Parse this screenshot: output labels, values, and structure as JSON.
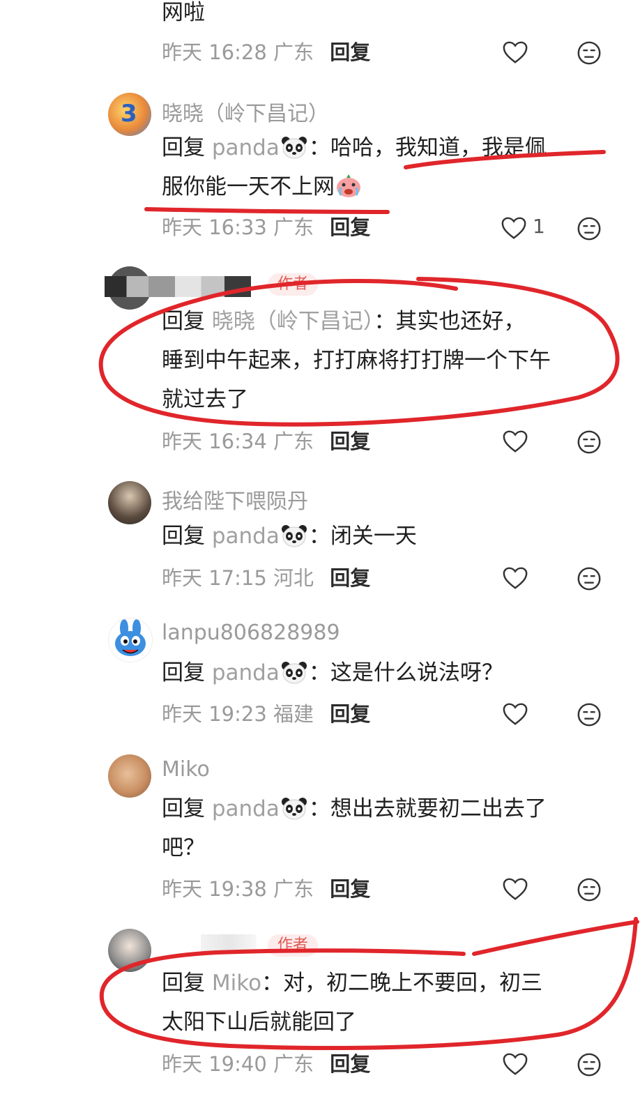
{
  "top_fragment": {
    "text": "网啦",
    "meta": {
      "date": "昨天",
      "time": "16:28",
      "region": "广东",
      "reply": "回复"
    }
  },
  "comments": [
    {
      "name": "晓晓（岭下昌记）",
      "reply_prefix": "回复",
      "reply_target": "panda",
      "sep": "：",
      "text_line1": "哈哈，我知道，我是佩",
      "text_line2": "服你能一天不上网",
      "meta": {
        "date": "昨天",
        "time": "16:33",
        "region": "广东",
        "reply": "回复"
      },
      "likes": "1"
    },
    {
      "badge": "作者",
      "reply_prefix": "回复",
      "reply_target": "晓晓（岭下昌记）",
      "sep": "：",
      "text_line1": "其实也还好，",
      "text_line2": "睡到中午起来，打打麻将打打牌一个下午",
      "text_line3": "就过去了",
      "meta": {
        "date": "昨天",
        "time": "16:34",
        "region": "广东",
        "reply": "回复"
      }
    },
    {
      "name": "我给陛下喂陨丹",
      "reply_prefix": "回复",
      "reply_target": "panda",
      "sep": "：",
      "text_line1": "闭关一天",
      "meta": {
        "date": "昨天",
        "time": "17:15",
        "region": "河北",
        "reply": "回复"
      }
    },
    {
      "name": "lanpu806828989",
      "reply_prefix": "回复",
      "reply_target": "panda",
      "sep": "：",
      "text_line1": "这是什么说法呀？",
      "meta": {
        "date": "昨天",
        "time": "19:23",
        "region": "福建",
        "reply": "回复"
      }
    },
    {
      "name": "Miko",
      "reply_prefix": "回复",
      "reply_target": "panda",
      "sep": "：",
      "text_line1": "想出去就要初二出去了",
      "text_line2": "吧？",
      "meta": {
        "date": "昨天",
        "time": "19:38",
        "region": "广东",
        "reply": "回复"
      }
    },
    {
      "badge": "作者",
      "reply_prefix": "回复",
      "reply_target": "Miko",
      "sep": "：",
      "text_line1": "对，初二晚上不要回，初三",
      "text_line2": "太阳下山后就能回了",
      "meta": {
        "date": "昨天",
        "time": "19:40",
        "region": "广东",
        "reply": "回复"
      }
    }
  ],
  "colors": {
    "annotation": "#e0262b",
    "meta": "#9a9a9a",
    "badge": "#e05b55"
  },
  "icons": {
    "like": "heart-outline-icon",
    "dislike": "expressionless-face-icon",
    "panda": "panda-emoji",
    "crying": "crying-emoji"
  }
}
